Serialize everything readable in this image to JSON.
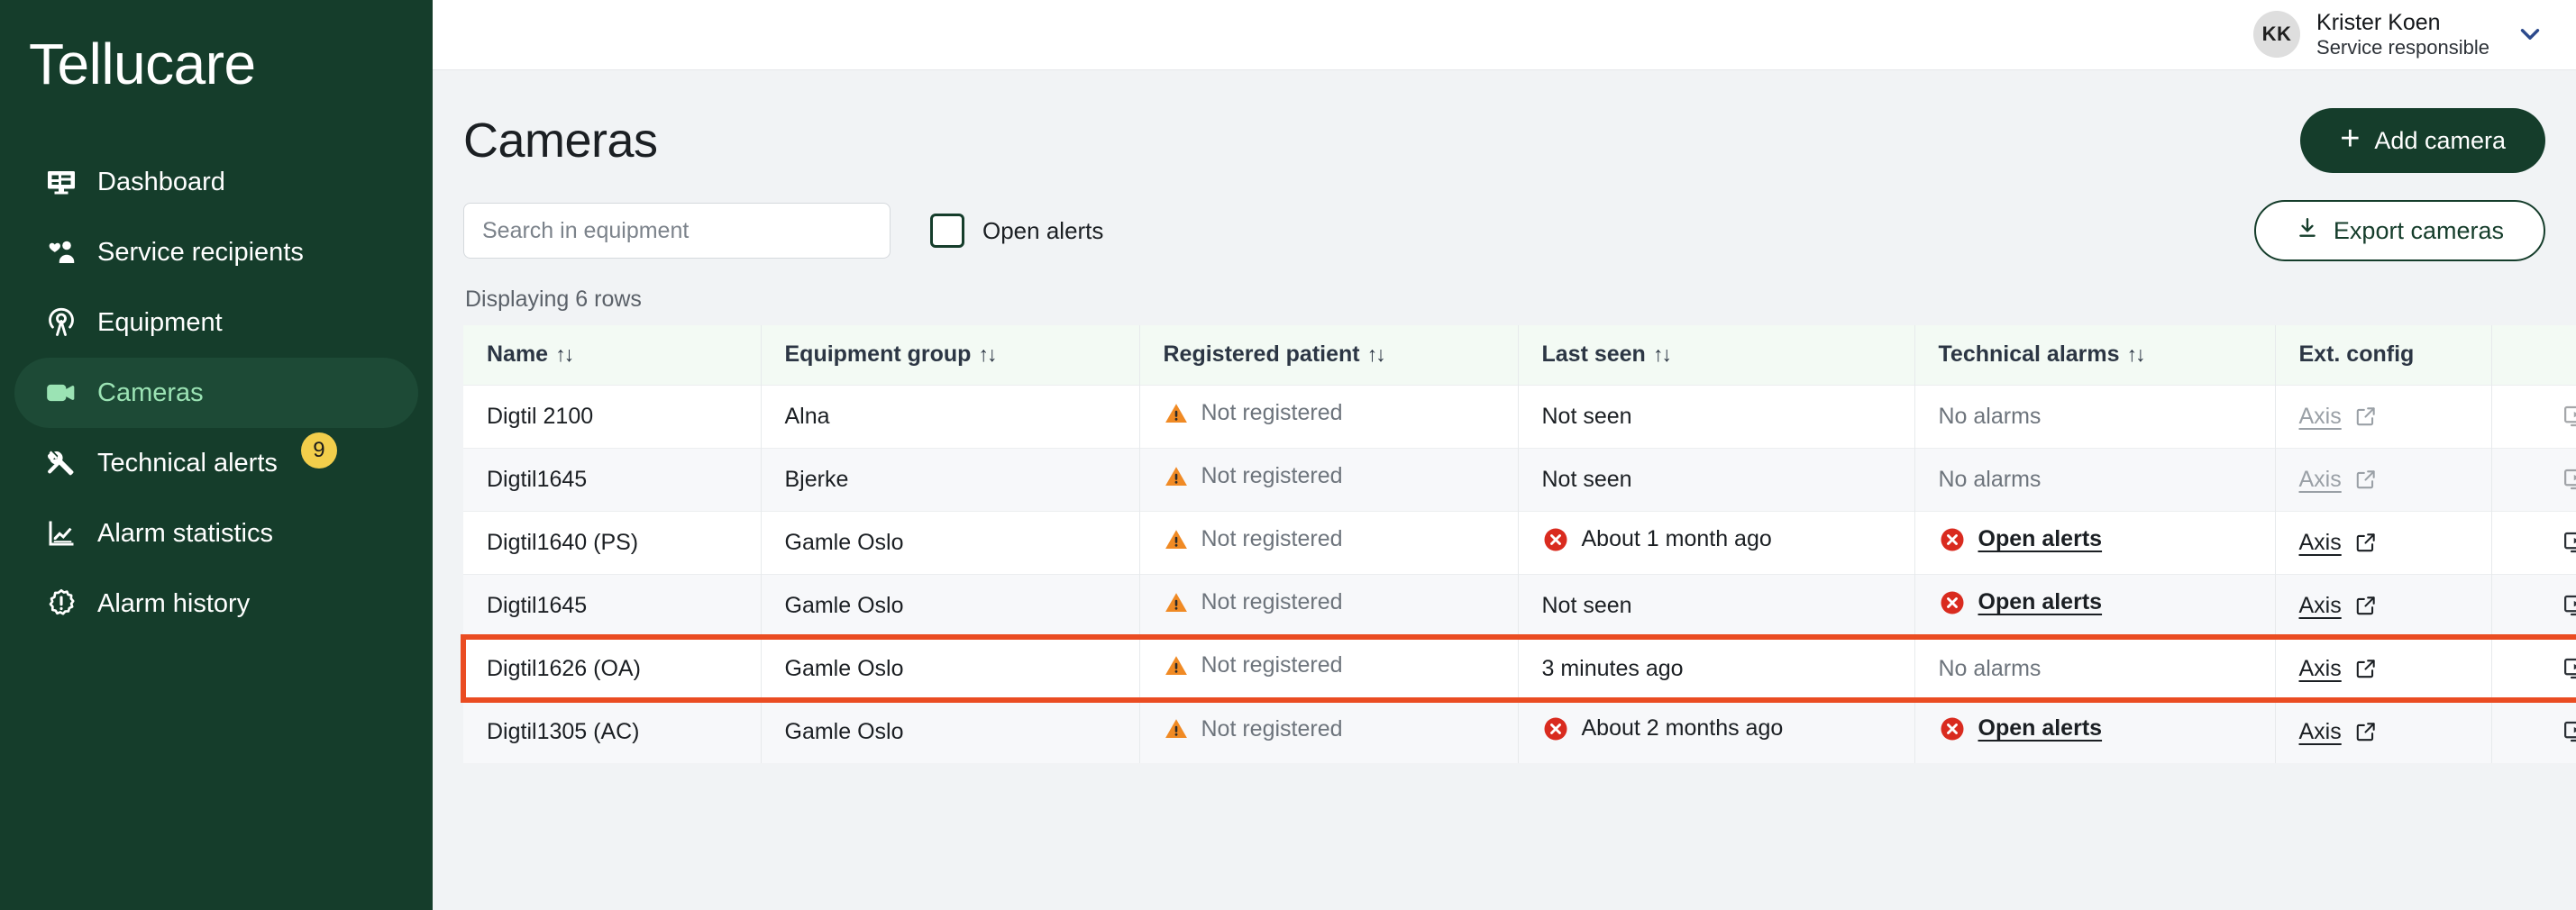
{
  "brand": {
    "name": "Tellucare"
  },
  "colors": {
    "sidebar_bg": "#153D2B",
    "sidebar_active_bg": "#1D4A36",
    "sidebar_active_text": "#9BE3B4",
    "badge_bg": "#F2CE4B",
    "primary": "#153D2B",
    "go_button": "#A5E8B8",
    "highlight_border": "#EA4C22",
    "warning": "#F08A24",
    "error": "#D92B1F",
    "table_header_bg": "#F3FAF4"
  },
  "sidebar": {
    "items": [
      {
        "label": "Dashboard",
        "icon": "dashboard-icon",
        "active": false,
        "badge": null
      },
      {
        "label": "Service recipients",
        "icon": "people-heart-icon",
        "active": false,
        "badge": null
      },
      {
        "label": "Equipment",
        "icon": "antenna-icon",
        "active": false,
        "badge": null
      },
      {
        "label": "Cameras",
        "icon": "video-camera-icon",
        "active": true,
        "badge": null
      },
      {
        "label": "Technical alerts",
        "icon": "tools-icon",
        "active": false,
        "badge": "9"
      },
      {
        "label": "Alarm statistics",
        "icon": "chart-line-icon",
        "active": false,
        "badge": null
      },
      {
        "label": "Alarm history",
        "icon": "alert-burst-icon",
        "active": false,
        "badge": null
      }
    ]
  },
  "topbar": {
    "user": {
      "initials": "KK",
      "name": "Krister Koen",
      "role": "Service responsible",
      "chevron_icon": "chevron-down-icon"
    }
  },
  "page": {
    "title": "Cameras",
    "add_button": {
      "label": "Add camera",
      "icon": "plus-icon"
    },
    "export_button": {
      "label": "Export cameras",
      "icon": "download-icon"
    },
    "search": {
      "placeholder": "Search in equipment",
      "value": ""
    },
    "open_alerts_filter": {
      "label": "Open alerts",
      "checked": false
    },
    "row_count_text": "Displaying 6 rows",
    "column_settings_button": {
      "icon": "columns-icon"
    }
  },
  "table": {
    "columns": [
      {
        "label": "Name",
        "sortable": true,
        "sort_icon": "sort-arrows-icon"
      },
      {
        "label": "Equipment group",
        "sortable": true,
        "sort_icon": "sort-arrows-icon"
      },
      {
        "label": "Registered patient",
        "sortable": true,
        "sort_icon": "sort-arrows-icon"
      },
      {
        "label": "Last seen",
        "sortable": true,
        "sort_icon": "sort-arrows-icon"
      },
      {
        "label": "Technical alarms",
        "sortable": true,
        "sort_icon": "sort-arrows-icon"
      },
      {
        "label": "Ext. config",
        "sortable": false,
        "sort_icon": null
      }
    ],
    "rows": [
      {
        "name": "Digtil 2100",
        "group": "Alna",
        "patient": {
          "text": "Not registered",
          "status": "warning"
        },
        "last_seen": {
          "text": "Not seen",
          "status": "none"
        },
        "alarms": {
          "text": "No alarms",
          "status": "none"
        },
        "ext_config": {
          "label": "Axis",
          "icon": "external-link-icon",
          "disabled": true
        },
        "monitor_icon": "monitor-play-icon",
        "monitor_disabled": true,
        "go_icon": "arrow-right-icon",
        "highlighted": false
      },
      {
        "name": "Digtil1645",
        "group": "Bjerke",
        "patient": {
          "text": "Not registered",
          "status": "warning"
        },
        "last_seen": {
          "text": "Not seen",
          "status": "none"
        },
        "alarms": {
          "text": "No alarms",
          "status": "none"
        },
        "ext_config": {
          "label": "Axis",
          "icon": "external-link-icon",
          "disabled": true
        },
        "monitor_icon": "monitor-play-icon",
        "monitor_disabled": true,
        "go_icon": "arrow-right-icon",
        "highlighted": false
      },
      {
        "name": "Digtil1640 (PS)",
        "group": "Gamle Oslo",
        "patient": {
          "text": "Not registered",
          "status": "warning"
        },
        "last_seen": {
          "text": "About 1 month ago",
          "status": "error"
        },
        "alarms": {
          "text": "Open alerts",
          "status": "error",
          "link": true
        },
        "ext_config": {
          "label": "Axis",
          "icon": "external-link-icon",
          "disabled": false
        },
        "monitor_icon": "monitor-play-icon",
        "monitor_disabled": false,
        "go_icon": "arrow-right-icon",
        "highlighted": false
      },
      {
        "name": "Digtil1645",
        "group": "Gamle Oslo",
        "patient": {
          "text": "Not registered",
          "status": "warning"
        },
        "last_seen": {
          "text": "Not seen",
          "status": "none"
        },
        "alarms": {
          "text": "Open alerts",
          "status": "error",
          "link": true
        },
        "ext_config": {
          "label": "Axis",
          "icon": "external-link-icon",
          "disabled": false
        },
        "monitor_icon": "monitor-play-icon",
        "monitor_disabled": false,
        "go_icon": "arrow-right-icon",
        "highlighted": false
      },
      {
        "name": "Digtil1626 (OA)",
        "group": "Gamle Oslo",
        "patient": {
          "text": "Not registered",
          "status": "warning"
        },
        "last_seen": {
          "text": "3 minutes ago",
          "status": "none"
        },
        "alarms": {
          "text": "No alarms",
          "status": "none"
        },
        "ext_config": {
          "label": "Axis",
          "icon": "external-link-icon",
          "disabled": false
        },
        "monitor_icon": "monitor-play-icon",
        "monitor_disabled": false,
        "go_icon": "arrow-right-icon",
        "highlighted": true
      },
      {
        "name": "Digtil1305 (AC)",
        "group": "Gamle Oslo",
        "patient": {
          "text": "Not registered",
          "status": "warning"
        },
        "last_seen": {
          "text": "About 2 months ago",
          "status": "error"
        },
        "alarms": {
          "text": "Open alerts",
          "status": "error",
          "link": true
        },
        "ext_config": {
          "label": "Axis",
          "icon": "external-link-icon",
          "disabled": false
        },
        "monitor_icon": "monitor-play-icon",
        "monitor_disabled": false,
        "go_icon": "arrow-right-icon",
        "highlighted": false
      }
    ]
  }
}
